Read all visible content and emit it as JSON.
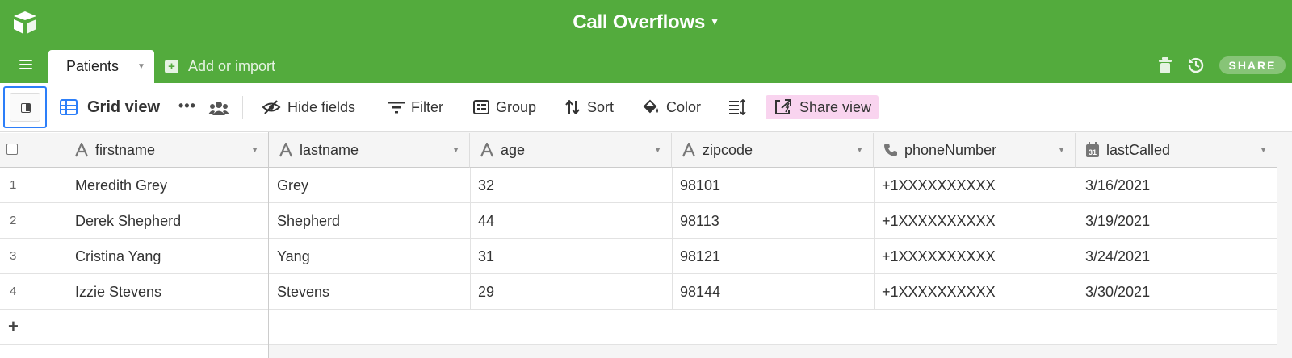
{
  "header": {
    "base_title": "Call Overflows",
    "logo_icon": "airtable-logo-icon",
    "accent_color": "#53ab3d"
  },
  "tabbar": {
    "active_tab": "Patients",
    "add_import_label": "Add or import",
    "share_label": "SHARE"
  },
  "toolbar": {
    "view_name": "Grid view",
    "more_label": "•••",
    "hide_fields": "Hide fields",
    "filter": "Filter",
    "group": "Group",
    "sort": "Sort",
    "color": "Color",
    "share_view": "Share view"
  },
  "grid": {
    "columns": [
      {
        "name": "firstname",
        "icon": "text-field-icon"
      },
      {
        "name": "lastname",
        "icon": "text-field-icon"
      },
      {
        "name": "age",
        "icon": "text-field-icon"
      },
      {
        "name": "zipcode",
        "icon": "text-field-icon"
      },
      {
        "name": "phoneNumber",
        "icon": "phone-field-icon"
      },
      {
        "name": "lastCalled",
        "icon": "date-field-icon"
      }
    ],
    "rows": [
      {
        "num": "1",
        "firstname": "Meredith Grey",
        "lastname": "Grey",
        "age": "32",
        "zipcode": "98101",
        "phoneNumber": "+1XXXXXXXXXX",
        "lastCalled": "3/16/2021"
      },
      {
        "num": "2",
        "firstname": "Derek Shepherd",
        "lastname": "Shepherd",
        "age": "44",
        "zipcode": "98113",
        "phoneNumber": "+1XXXXXXXXXX",
        "lastCalled": "3/19/2021"
      },
      {
        "num": "3",
        "firstname": "Cristina Yang",
        "lastname": "Yang",
        "age": "31",
        "zipcode": "98121",
        "phoneNumber": "+1XXXXXXXXXX",
        "lastCalled": "3/24/2021"
      },
      {
        "num": "4",
        "firstname": "Izzie Stevens",
        "lastname": "Stevens",
        "age": "29",
        "zipcode": "98144",
        "phoneNumber": "+1XXXXXXXXXX",
        "lastCalled": "3/30/2021"
      }
    ],
    "add_row_label": "+"
  }
}
